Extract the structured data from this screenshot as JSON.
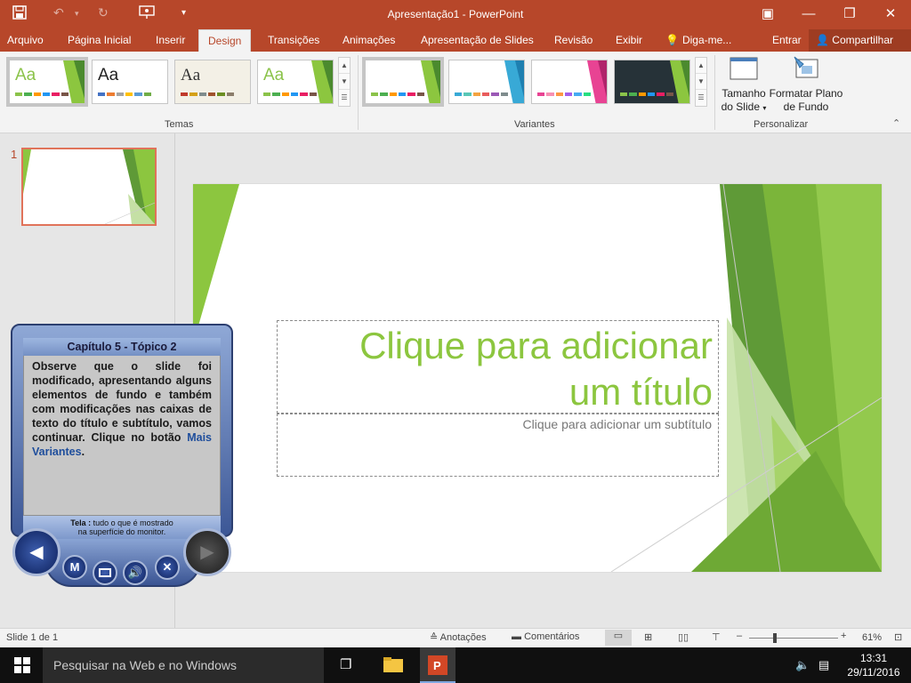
{
  "titlebar": {
    "title": "Apresentação1 - PowerPoint",
    "icons": [
      "save-icon",
      "undo-icon",
      "redo-icon",
      "present-icon",
      "customize-icon"
    ]
  },
  "window_controls": {
    "restore_ribbon": "▣",
    "minimize": "—",
    "maximize": "❐",
    "close": "✕"
  },
  "tabs": {
    "file": "Arquivo",
    "home": "Página Inicial",
    "insert": "Inserir",
    "design": "Design",
    "transitions": "Transições",
    "animations": "Animações",
    "slideshow": "Apresentação de Slides",
    "review": "Revisão",
    "view": "Exibir",
    "tell_me": "Diga-me...",
    "sign_in": "Entrar",
    "share": "Compartilhar"
  },
  "ribbon": {
    "themes_label": "Temas",
    "variants_label": "Variantes",
    "customize_label": "Personalizar",
    "themes": [
      {
        "sample": "Aa",
        "text_color": "#8bc34a",
        "bars": [
          "#8bc34a",
          "#4caf50",
          "#ff9800",
          "#2196f3",
          "#e91e63",
          "#795548"
        ]
      },
      {
        "sample": "Aa",
        "text_color": "#222222",
        "bars": [
          "#4472c4",
          "#ed7d31",
          "#a5a5a5",
          "#ffc000",
          "#5b9bd5",
          "#70ad47"
        ]
      },
      {
        "sample": "Aa",
        "text_color": "#333333",
        "bars": [
          "#c0392b",
          "#d4a017",
          "#7f8c8d",
          "#a0522d",
          "#6b8e23",
          "#8b7d6b"
        ]
      },
      {
        "sample": "Aa",
        "text_color": "#8bc34a",
        "bars": [
          "#8bc34a",
          "#4caf50",
          "#ff9800",
          "#2196f3",
          "#e91e63",
          "#795548"
        ]
      }
    ],
    "variants": [
      {
        "bars": [
          "#8bc34a",
          "#4caf50",
          "#ff9800",
          "#2196f3",
          "#e91e63",
          "#795548"
        ],
        "bg": "#ffffff",
        "accent": "#8bc34a"
      },
      {
        "bars": [
          "#38a9d6",
          "#58c7b6",
          "#f4a340",
          "#e85c5c",
          "#9b59b6",
          "#7f8c8d"
        ],
        "bg": "#ffffff",
        "accent": "#38a9d6"
      },
      {
        "bars": [
          "#e84393",
          "#f78fb3",
          "#fd9644",
          "#a55eea",
          "#45aaf2",
          "#26de81"
        ],
        "bg": "#ffffff",
        "accent": "#e84393"
      },
      {
        "bars": [
          "#8bc34a",
          "#4caf50",
          "#ff9800",
          "#2196f3",
          "#e91e63",
          "#795548"
        ],
        "bg": "#263238",
        "accent": "#8bc34a"
      }
    ],
    "slide_size_line1": "Tamanho",
    "slide_size_line2": "do Slide",
    "format_bg_line1": "Formatar Plano",
    "format_bg_line2": "de Fundo"
  },
  "thumbnail": {
    "number": "1"
  },
  "slide": {
    "title_placeholder_line1": "Clique para adicionar",
    "title_placeholder_line2": "um título",
    "subtitle_placeholder": "Clique para adicionar um subtítulo",
    "accent": "#8cc63f"
  },
  "tutorial": {
    "heading": "Capítulo 5 - Tópico 2",
    "body": "Observe que o slide foi modificado, apresentando alguns elementos de fundo e também com modificações nas caixas de texto do título e subtítulo, vamos continuar. Clique no botão",
    "link": "Mais Variantes",
    "body_end": ".",
    "term": "Tela :",
    "definition_line1": "tudo o que é mostrado",
    "definition_line2": "na superfície do monitor.",
    "btn_m": "M",
    "btn_x": "✕"
  },
  "statusbar": {
    "slide_info": "Slide 1 de 1",
    "notes": "Anotações",
    "comments": "Comentários",
    "zoom": "61%"
  },
  "taskbar": {
    "search_placeholder": "Pesquisar na Web e no Windows",
    "time": "13:31",
    "date": "29/11/2016"
  }
}
